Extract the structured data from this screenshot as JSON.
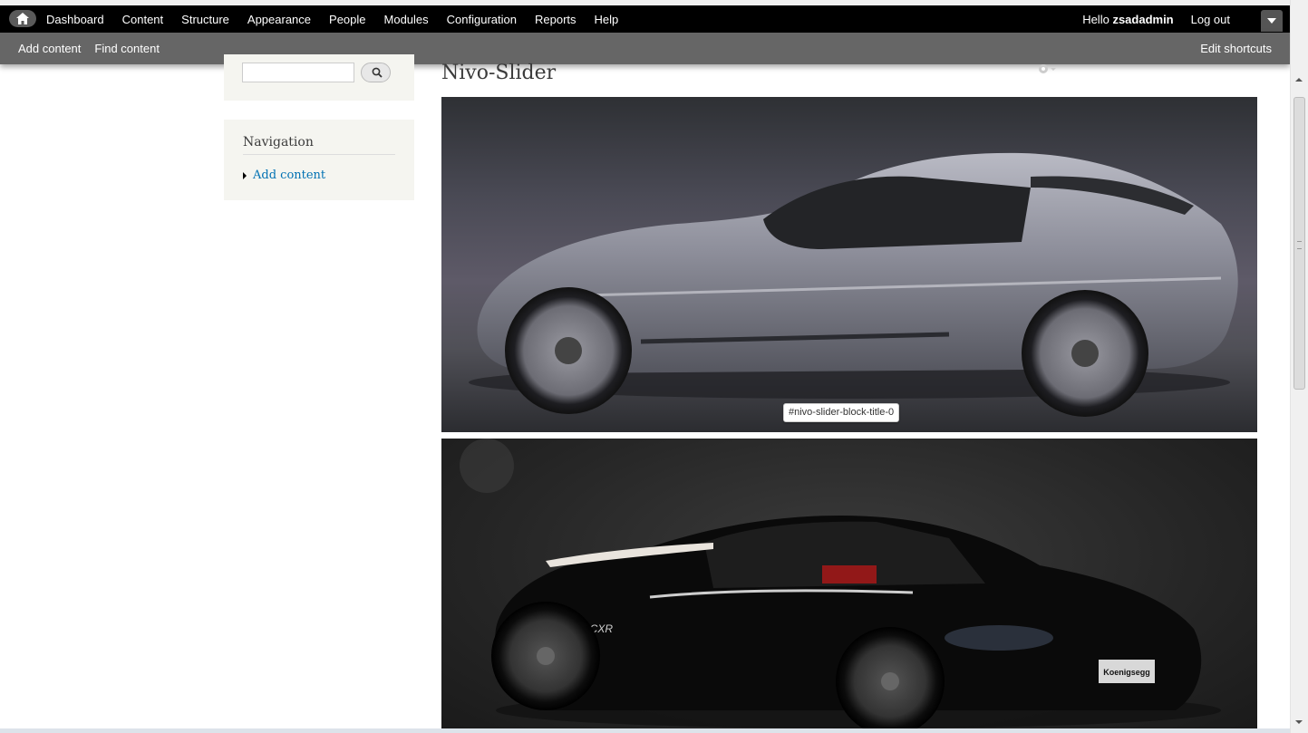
{
  "toolbar": {
    "menu": [
      "Dashboard",
      "Content",
      "Structure",
      "Appearance",
      "People",
      "Modules",
      "Configuration",
      "Reports",
      "Help"
    ],
    "hello_prefix": "Hello ",
    "username": "zsadadmin",
    "logout": "Log out"
  },
  "shortcuts": {
    "items": [
      "Add content",
      "Find content"
    ],
    "edit": "Edit shortcuts"
  },
  "search": {
    "value": ""
  },
  "navigation": {
    "title": "Navigation",
    "items": [
      "Add content"
    ]
  },
  "main": {
    "title": "Nivo-Slider",
    "tooltip": "#nivo-slider-block-title-0",
    "car2_badge": "CCXR",
    "car2_plate": "Koenigsegg"
  },
  "colors": {
    "toolbar_bg": "#000000",
    "shortcuts_bg": "#666666",
    "link": "#0071b3",
    "block_bg": "#f5f5f0"
  }
}
